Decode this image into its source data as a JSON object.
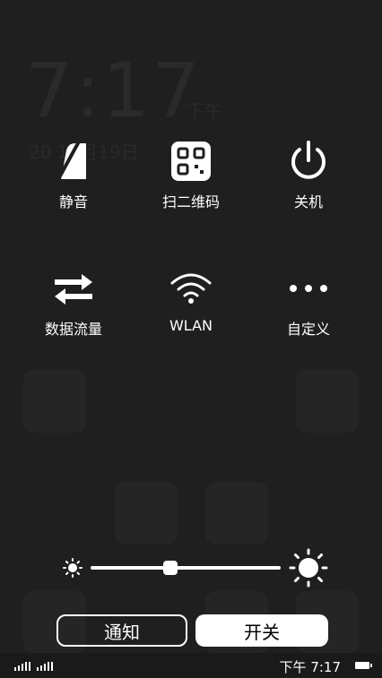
{
  "tiles": {
    "silent": "静音",
    "scan_qr": "扫二维码",
    "power_off": "关机",
    "mobile_data": "数据流量",
    "wlan": "WLAN",
    "custom": "自定义"
  },
  "brightness": {
    "level": 0.42
  },
  "buttons": {
    "notification": "通知",
    "switches": "开关"
  },
  "status_bar": {
    "time": "下午 7:17"
  },
  "icons": {
    "silent": "bell-slash-icon",
    "scan_qr": "qr-code-icon",
    "power_off": "power-icon",
    "mobile_data": "swap-arrows-icon",
    "wlan": "wifi-icon",
    "custom": "more-dots-icon",
    "brightness_low": "sun-small-icon",
    "brightness_high": "sun-large-icon"
  }
}
